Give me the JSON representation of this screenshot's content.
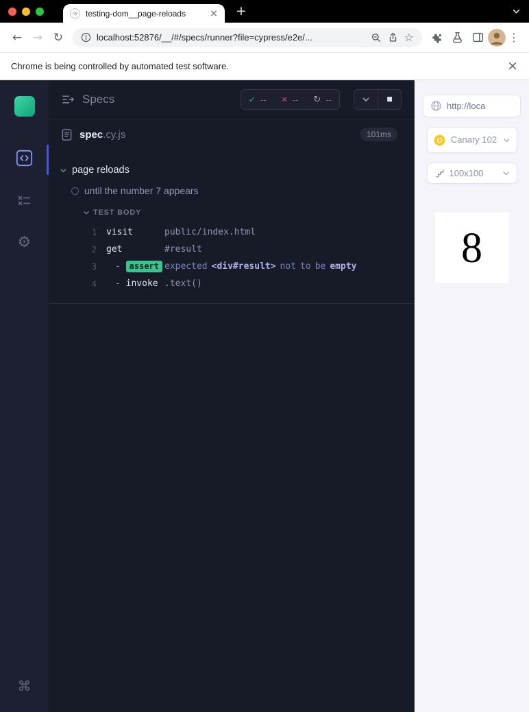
{
  "icons": {
    "favicon": "cy",
    "close": "×",
    "plus": "+",
    "back": "←",
    "forward": "→",
    "reload": "↻",
    "star": "☆",
    "overflow": "⋮",
    "check": "✓",
    "cross": "✕",
    "refresh": "↻",
    "stop": "■",
    "gear": "⚙",
    "command": "⌘"
  },
  "browser_chrome": {
    "tab_title": "testing-dom__page-reloads",
    "url": "localhost:52876/__/#/specs/runner?file=cypress/e2e/...",
    "infobar_message": "Chrome is being controlled by automated test software."
  },
  "runner": {
    "title": "Specs",
    "stats": {
      "passed": "--",
      "failed": "--",
      "pending": "--"
    },
    "spec_file": {
      "name": "spec",
      "ext": ".cy.js",
      "duration": "101ms"
    },
    "suite_title": "page reloads",
    "test_title": "until the number 7 appears",
    "body_label": "TEST BODY",
    "commands": [
      {
        "num": "1",
        "name": "visit",
        "message": "public/index.html"
      },
      {
        "num": "2",
        "name": "get",
        "message": "#result"
      },
      {
        "num": "3",
        "dash": "-",
        "name": "assert",
        "assert_message": {
          "pre": "expected",
          "target": "<div#result>",
          "mid1": "not",
          "mid2": "to",
          "mid3": "be",
          "state": "empty"
        }
      },
      {
        "num": "4",
        "dash": "-",
        "name": "invoke",
        "message": ".text()"
      }
    ]
  },
  "aut": {
    "url": "http://loca",
    "browser_label": "Canary 102",
    "viewport_label": "100x100",
    "app_value": "8"
  }
}
